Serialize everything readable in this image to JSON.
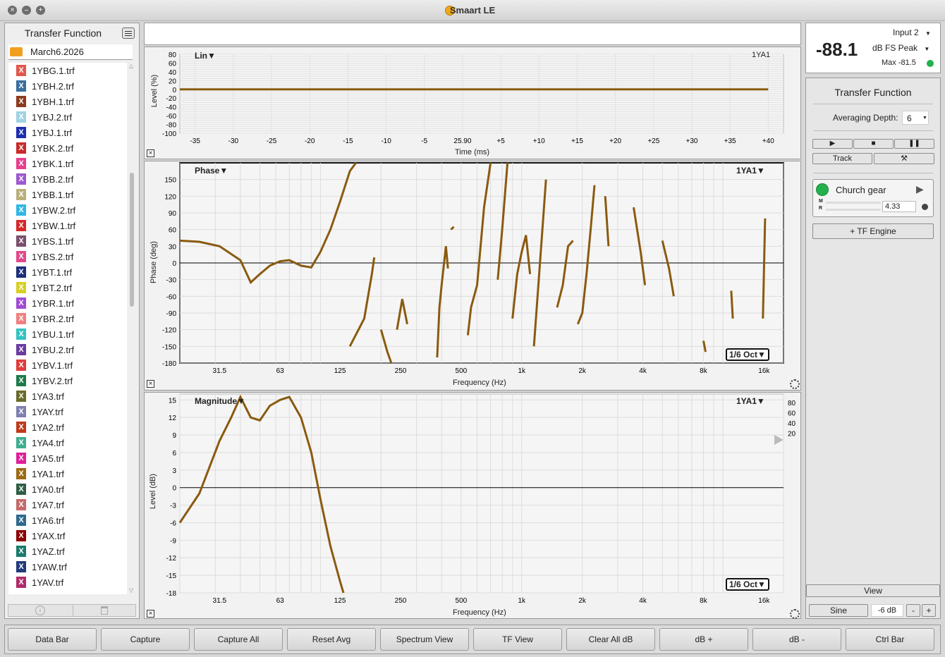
{
  "window": {
    "title": "Smaart LE"
  },
  "file_panel": {
    "title": "Transfer Function",
    "folder": "March6.2026",
    "files": [
      {
        "name": "1YBG.1.trf",
        "color": "#e2574c"
      },
      {
        "name": "1YBH.2.trf",
        "color": "#3b6e9e"
      },
      {
        "name": "1YBH.1.trf",
        "color": "#8b3a1c"
      },
      {
        "name": "1YBJ.2.trf",
        "color": "#9fd3e3"
      },
      {
        "name": "1YBJ.1.trf",
        "color": "#1d2fb0"
      },
      {
        "name": "1YBK.2.trf",
        "color": "#c92a2a"
      },
      {
        "name": "1YBK.1.trf",
        "color": "#e83e8c"
      },
      {
        "name": "1YBB.2.trf",
        "color": "#9b59d0"
      },
      {
        "name": "1YBB.1.trf",
        "color": "#b9b07a"
      },
      {
        "name": "1YBW.2.trf",
        "color": "#2eb8e6"
      },
      {
        "name": "1YBW.1.trf",
        "color": "#d62828"
      },
      {
        "name": "1YBS.1.trf",
        "color": "#7a4f6d"
      },
      {
        "name": "1YBS.2.trf",
        "color": "#e24a8a"
      },
      {
        "name": "1YBT.1.trf",
        "color": "#1c2f7a"
      },
      {
        "name": "1YBT.2.trf",
        "color": "#d8d020"
      },
      {
        "name": "1YBR.1.trf",
        "color": "#a14bd4"
      },
      {
        "name": "1YBR.2.trf",
        "color": "#f08080"
      },
      {
        "name": "1YBU.1.trf",
        "color": "#33c2c2"
      },
      {
        "name": "1YBU.2.trf",
        "color": "#6a3ca0"
      },
      {
        "name": "1YBV.1.trf",
        "color": "#e03b3b"
      },
      {
        "name": "1YBV.2.trf",
        "color": "#1f7a4a"
      },
      {
        "name": "1YA3.trf",
        "color": "#6b6b2b"
      },
      {
        "name": "1YAY.trf",
        "color": "#7f7fb0"
      },
      {
        "name": "1YA2.trf",
        "color": "#c0391b"
      },
      {
        "name": "1YA4.trf",
        "color": "#3fae8f"
      },
      {
        "name": "1YA5.trf",
        "color": "#e0209a"
      },
      {
        "name": "1YA1.trf",
        "color": "#9c6b12"
      },
      {
        "name": "1YA0.trf",
        "color": "#2f5f45"
      },
      {
        "name": "1YA7.trf",
        "color": "#c56a6a"
      },
      {
        "name": "1YA6.trf",
        "color": "#2f6a8e"
      },
      {
        "name": "1YAX.trf",
        "color": "#8b0000"
      },
      {
        "name": "1YAZ.trf",
        "color": "#1a7a6a"
      },
      {
        "name": "1YAW.trf",
        "color": "#203a7a"
      },
      {
        "name": "1YAV.trf",
        "color": "#b02a6a"
      }
    ]
  },
  "impulse_plot": {
    "title": "Lin",
    "trace_name": "1YA1",
    "ylabel": "Level (%)",
    "xlabel": "Time (ms)",
    "yticks": [
      "80",
      "60",
      "40",
      "20",
      "0",
      "-20",
      "-40",
      "-60",
      "-80",
      "-100"
    ],
    "xticks": [
      "-35",
      "-30",
      "-25",
      "-20",
      "-15",
      "-10",
      "-5",
      "25.90",
      "+5",
      "+10",
      "+15",
      "+20",
      "+25",
      "+30",
      "+35",
      "+40"
    ]
  },
  "phase_plot": {
    "title": "Phase",
    "trace_name": "1YA1",
    "ylabel": "Phase (deg)",
    "xlabel": "Frequency (Hz)",
    "smoothing": "1/6 Oct",
    "yticks": [
      "150",
      "120",
      "90",
      "60",
      "30",
      "0",
      "-30",
      "-60",
      "-90",
      "-120",
      "-150",
      "-180"
    ],
    "xticks": [
      "31.5",
      "63",
      "125",
      "250",
      "500",
      "1k",
      "2k",
      "4k",
      "8k",
      "16k"
    ]
  },
  "magnitude_plot": {
    "title": "Magnitude",
    "trace_name": "1YA1",
    "ylabel": "Level (dB)",
    "xlabel": "Frequency (Hz)",
    "smoothing": "1/6 Oct",
    "yticks": [
      "15",
      "12",
      "9",
      "6",
      "3",
      "0",
      "-3",
      "-6",
      "-9",
      "-12",
      "-15",
      "-18"
    ],
    "coherence_ticks": [
      "80",
      "60",
      "40",
      "20"
    ],
    "xticks": [
      "31.5",
      "63",
      "125",
      "250",
      "500",
      "1k",
      "2k",
      "4k",
      "8k",
      "16k"
    ]
  },
  "chart_data": [
    {
      "type": "line",
      "title": "Lin",
      "xlabel": "Time (ms)",
      "ylabel": "Level (%)",
      "ylim": [
        -100,
        80
      ],
      "series": [
        {
          "name": "1YA1",
          "x": [
            -35,
            -25,
            -15,
            -5,
            5,
            15,
            25,
            35,
            40
          ],
          "y": [
            0,
            0,
            0,
            0,
            0,
            0,
            0,
            0,
            0
          ]
        }
      ]
    },
    {
      "type": "line",
      "title": "Phase",
      "xlabel": "Frequency (Hz)",
      "ylabel": "Phase (deg)",
      "ylim": [
        -180,
        180
      ],
      "series": [
        {
          "name": "1YA1",
          "x": [
            20,
            25,
            31.5,
            40,
            45,
            50,
            56,
            63,
            70,
            80,
            90,
            100,
            112,
            125,
            140,
            150
          ],
          "y": [
            40,
            38,
            30,
            5,
            -35,
            -20,
            -5,
            3,
            5,
            -5,
            -8,
            20,
            60,
            110,
            165,
            180
          ]
        }
      ]
    },
    {
      "type": "line",
      "title": "Magnitude",
      "xlabel": "Frequency (Hz)",
      "ylabel": "Level (dB)",
      "ylim": [
        -18,
        16
      ],
      "series": [
        {
          "name": "1YA1",
          "x": [
            20,
            25,
            31.5,
            36,
            40,
            45,
            50,
            56,
            63,
            70,
            80,
            90,
            100,
            112,
            125,
            130
          ],
          "y": [
            -6,
            -1,
            8,
            12,
            15.5,
            12,
            11.5,
            14,
            15,
            15.5,
            12,
            6,
            -2,
            -10,
            -16,
            -18
          ]
        }
      ]
    }
  ],
  "meter": {
    "value": "-88.1",
    "input": "Input 2",
    "mode": "dB FS Peak",
    "max": "Max -81.5"
  },
  "control_panel": {
    "title": "Transfer Function",
    "averaging_label": "Averaging Depth:",
    "averaging_value": "6",
    "track_label": "Track",
    "engine_name": "Church gear",
    "delay_value": "4.33",
    "add_engine_label": "+ TF Engine",
    "m_label": "M",
    "r_label": "R",
    "view_label": "View",
    "signal_label": "Sine",
    "signal_level": "-6 dB",
    "minus_label": "-",
    "plus_label": "+"
  },
  "bottom_buttons": [
    "Data Bar",
    "Capture",
    "Capture All",
    "Reset Avg",
    "Spectrum View",
    "TF View",
    "Clear All dB",
    "dB +",
    "dB -",
    "Ctrl Bar"
  ],
  "colors": {
    "trace": "#8a5a0f",
    "accent_green": "#22b14c"
  }
}
